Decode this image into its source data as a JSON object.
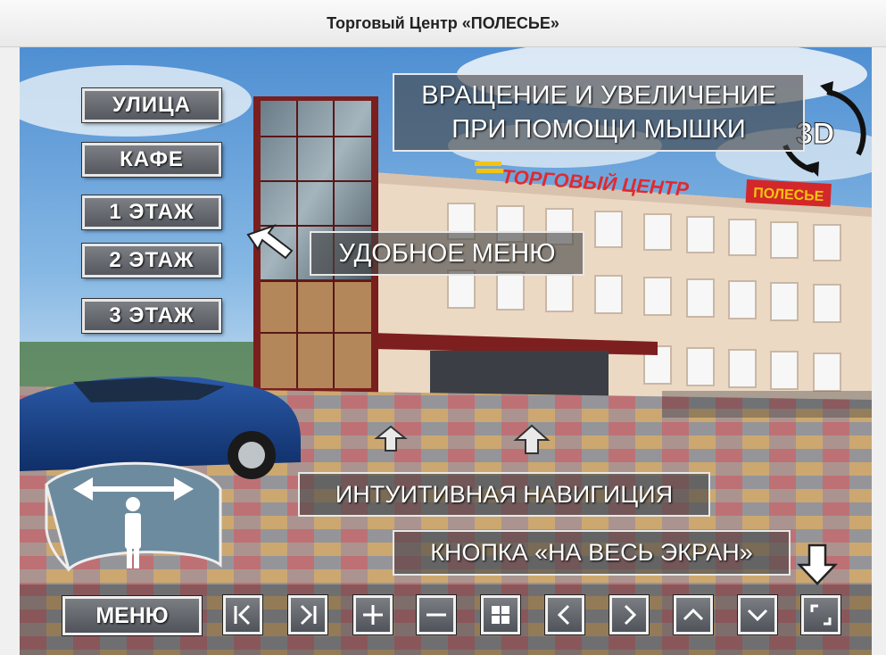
{
  "window": {
    "title": "Торговый Центр «ПОЛЕСЬЕ»"
  },
  "building_sign": {
    "left": "ТОРГОВЫЙ ЦЕНТР",
    "right": "ПОЛЕСЬЕ"
  },
  "floor_menu": {
    "items": [
      {
        "label": "УЛИЦА"
      },
      {
        "label": "КАФЕ"
      },
      {
        "label": "1 ЭТАЖ"
      },
      {
        "label": "2 ЭТАЖ"
      },
      {
        "label": "3 ЭТАЖ"
      }
    ]
  },
  "callouts": {
    "rotate": "ВРАЩЕНИЕ И УВЕЛИЧЕНИЕ\nПРИ ПОМОЩИ МЫШКИ",
    "badge_3d": "3D",
    "menu": "УДОБНОЕ МЕНЮ",
    "navigation": "ИНТУИТИВНАЯ НАВИГИЦИЯ",
    "fullscreen": "КНОПКА «НА ВЕСЬ ЭКРАН»"
  },
  "toolbar": {
    "menu_label": "МЕНЮ",
    "buttons": [
      "first-icon",
      "last-icon",
      "plus-icon",
      "minus-icon",
      "grid-icon",
      "chevron-left-icon",
      "chevron-right-icon",
      "chevron-up-icon",
      "chevron-down-icon",
      "fullscreen-icon"
    ]
  },
  "colors": {
    "sign_yellow": "#f2c40f",
    "sign_red": "#d3272a",
    "button_gray": "#62666c"
  }
}
